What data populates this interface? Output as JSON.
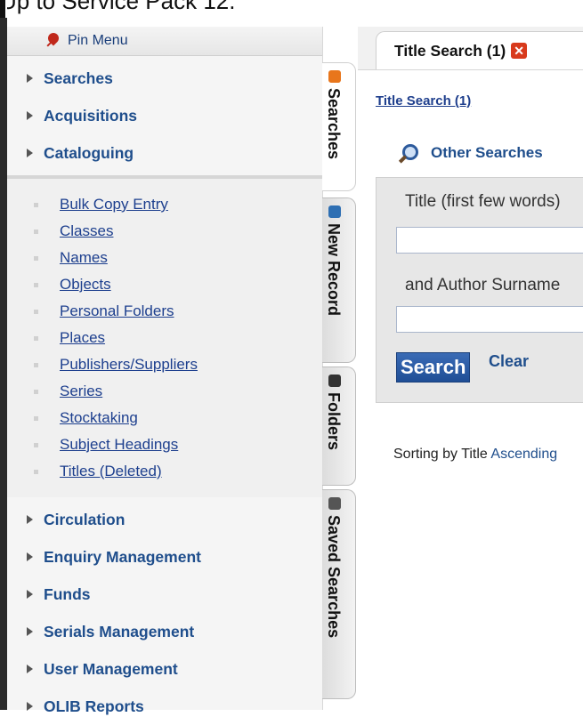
{
  "caption": "Up to Service Pack 12.",
  "pin_menu": {
    "label": "Pin Menu",
    "icon": "pin-icon"
  },
  "sidebar": {
    "sections_top": [
      "Searches",
      "Acquisitions",
      "Cataloguing"
    ],
    "cataloguing_items": [
      "Bulk Copy Entry",
      "Classes",
      "Names",
      "Objects",
      "Personal Folders",
      "Places",
      "Publishers/Suppliers",
      "Series",
      "Stocktaking",
      "Subject Headings",
      "Titles (Deleted)"
    ],
    "sections_bottom": [
      "Circulation",
      "Enquiry Management",
      "Funds",
      "Serials Management",
      "User Management",
      "OLIB Reports"
    ]
  },
  "vtabs": [
    {
      "label": "Searches",
      "color": "#e8761c"
    },
    {
      "label": "New Record",
      "color": "#2e6fb3"
    },
    {
      "label": "Folders",
      "color": "#333333"
    },
    {
      "label": "Saved Searches",
      "color": "#555555"
    }
  ],
  "main": {
    "tab_label": "Title Search (1)",
    "breadcrumb": "Title Search (1)",
    "other_searches": "Other Searches",
    "title_label": "Title (first few words)",
    "author_label": "and Author Surname",
    "search_button": "Search",
    "clear_link": "Clear",
    "sorting_prefix": "Sorting by Title",
    "sorting_direction": "Ascending"
  }
}
